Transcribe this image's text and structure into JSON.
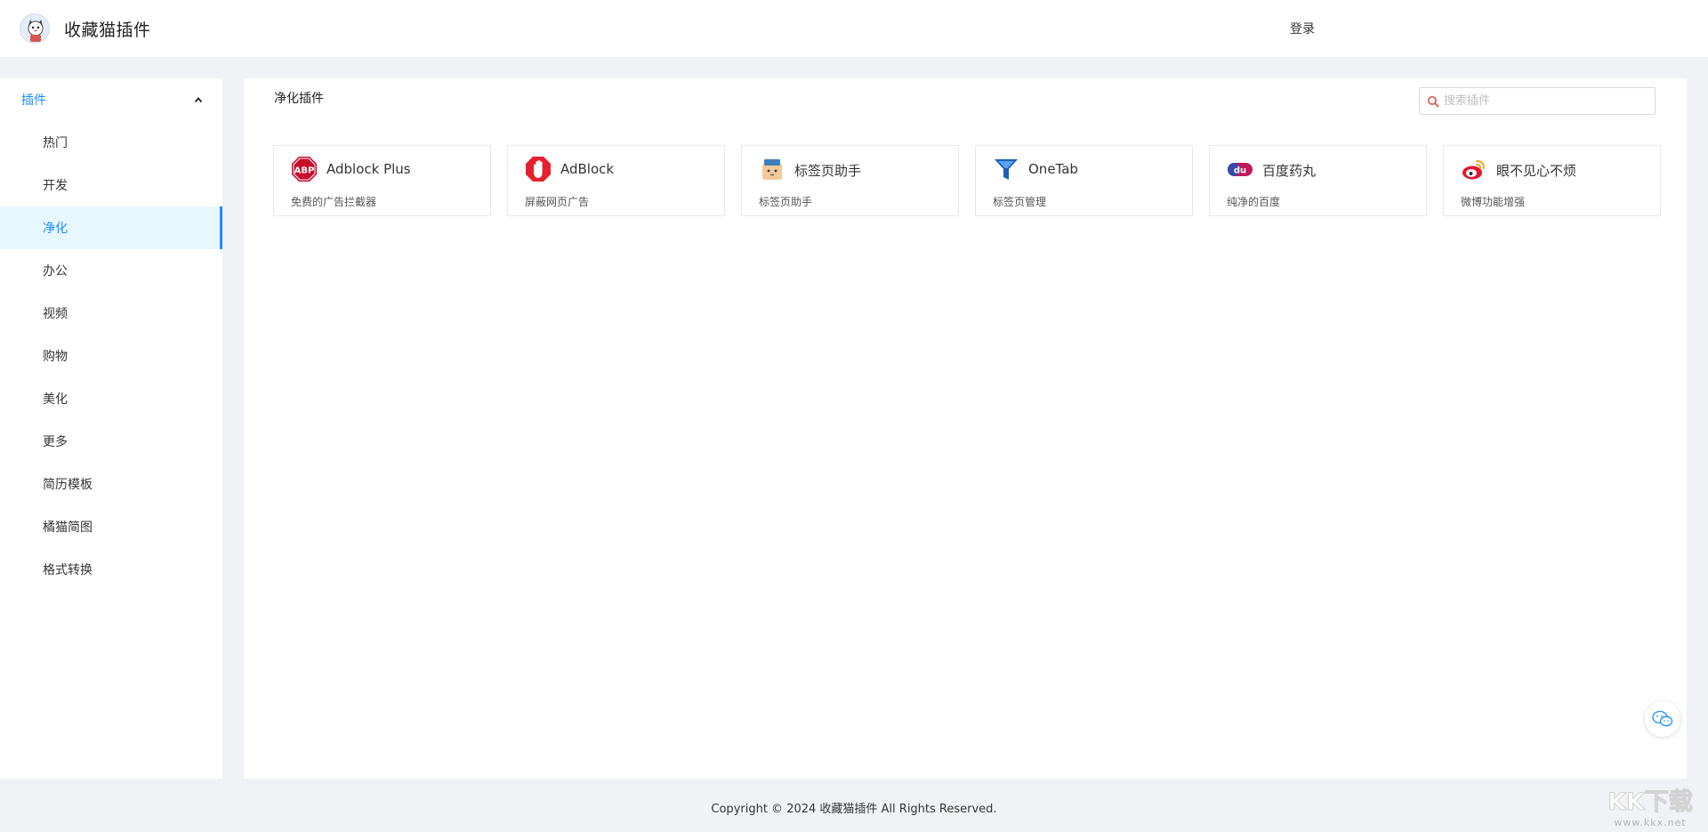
{
  "header": {
    "app_title": "收藏猫插件",
    "login_label": "登录"
  },
  "sidebar": {
    "group": {
      "label": "插件",
      "expanded": true,
      "icon": "chevron-up-icon"
    },
    "items": [
      {
        "label": "热门",
        "active": false
      },
      {
        "label": "开发",
        "active": false
      },
      {
        "label": "净化",
        "active": true
      },
      {
        "label": "办公",
        "active": false
      },
      {
        "label": "视频",
        "active": false
      },
      {
        "label": "购物",
        "active": false
      },
      {
        "label": "美化",
        "active": false
      },
      {
        "label": "更多",
        "active": false
      },
      {
        "label": "简历模板",
        "active": false
      },
      {
        "label": "橘猫简图",
        "active": false
      },
      {
        "label": "格式转换",
        "active": false
      }
    ]
  },
  "main": {
    "section_title": "净化插件",
    "search": {
      "placeholder": "搜索插件",
      "value": ""
    },
    "plugins": [
      {
        "name": "Adblock Plus",
        "desc": "免费的广告拦截器",
        "icon": "adblock-plus-icon"
      },
      {
        "name": "AdBlock",
        "desc": "屏蔽网页广告",
        "icon": "adblock-hand-icon"
      },
      {
        "name": "标签页助手",
        "desc": "标签页助手",
        "icon": "tab-helper-icon"
      },
      {
        "name": "OneTab",
        "desc": "标签页管理",
        "icon": "onetab-funnel-icon"
      },
      {
        "name": "百度药丸",
        "desc": "纯净的百度",
        "icon": "baidu-du-icon"
      },
      {
        "name": "眼不见心不烦",
        "desc": "微博功能增强",
        "icon": "weibo-icon"
      }
    ]
  },
  "footer": {
    "copyright": "Copyright © 2024 收藏猫插件 All Rights Reserved."
  },
  "watermark": {
    "text": "KK下载",
    "url": "www.kkx.net"
  },
  "colors": {
    "accent": "#1890ff",
    "active_bg": "#e6f7ff",
    "page_bg": "#f0f2f5"
  }
}
